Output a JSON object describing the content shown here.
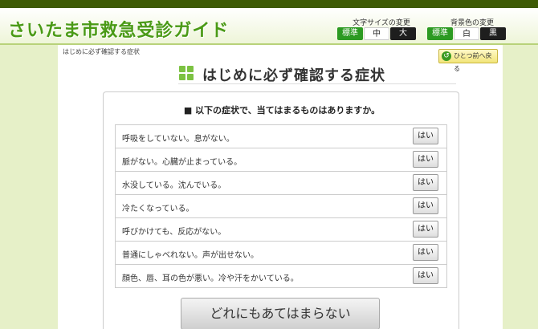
{
  "header": {
    "title": "さいたま市救急受診ガイド",
    "font_size": {
      "label": "文字サイズの変更",
      "options": [
        "標準",
        "中",
        "大"
      ]
    },
    "bg_color": {
      "label": "背景色の変更",
      "options": [
        "標準",
        "白",
        "黒"
      ]
    }
  },
  "breadcrumb": "はじめに必ず確認する症状",
  "back_button": "ひとつ前へ戻る",
  "page_title": "はじめに必ず確認する症状",
  "question": "■ 以下の症状で、当てはまるものはありますか。",
  "yes_label": "はい",
  "symptoms": [
    "呼吸をしていない。息がない。",
    "脈がない。心臓が止まっている。",
    "水没している。沈んでいる。",
    "冷たくなっている。",
    "呼びかけても、反応がない。",
    "普通にしゃべれない。声が出せない。",
    "顔色、唇、耳の色が悪い。冷や汗をかいている。"
  ],
  "none_button": "どれにもあてはまらない",
  "colors": {
    "brand_green": "#4a9a16",
    "topbar": "#3d5a06",
    "page_bg": "#e6f0c8"
  }
}
